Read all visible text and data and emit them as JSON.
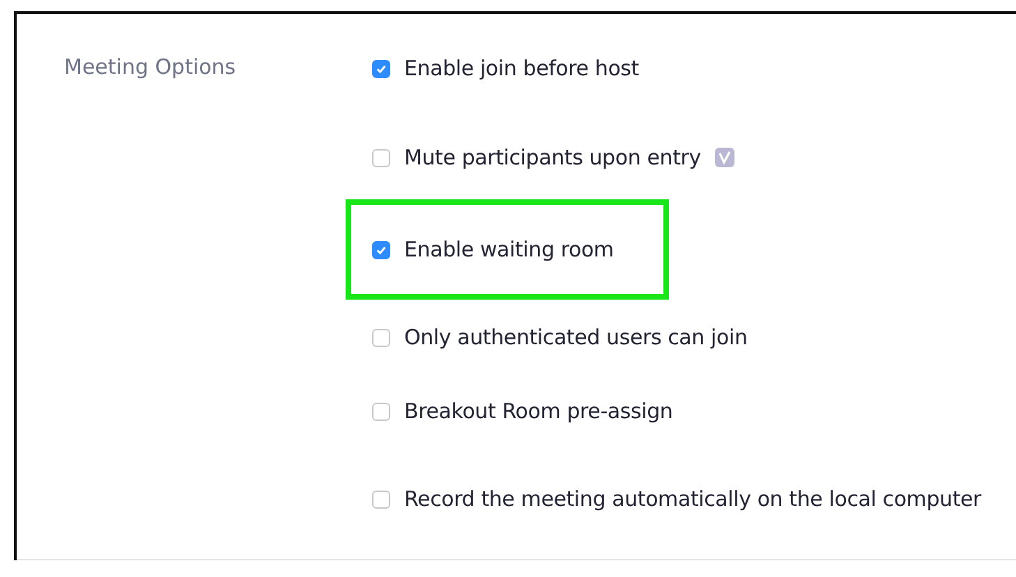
{
  "section": {
    "label": "Meeting Options"
  },
  "options": [
    {
      "label": "Enable join before host",
      "checked": true,
      "highlighted": false,
      "badge": false
    },
    {
      "label": "Mute participants upon entry",
      "checked": false,
      "highlighted": false,
      "badge": true
    },
    {
      "label": "Enable waiting room",
      "checked": true,
      "highlighted": true,
      "badge": false
    },
    {
      "label": "Only authenticated users can join",
      "checked": false,
      "highlighted": false,
      "badge": false
    },
    {
      "label": "Breakout Room pre-assign",
      "checked": false,
      "highlighted": false,
      "badge": false
    },
    {
      "label": "Record the meeting automatically on the local computer",
      "checked": false,
      "highlighted": false,
      "badge": false
    }
  ]
}
